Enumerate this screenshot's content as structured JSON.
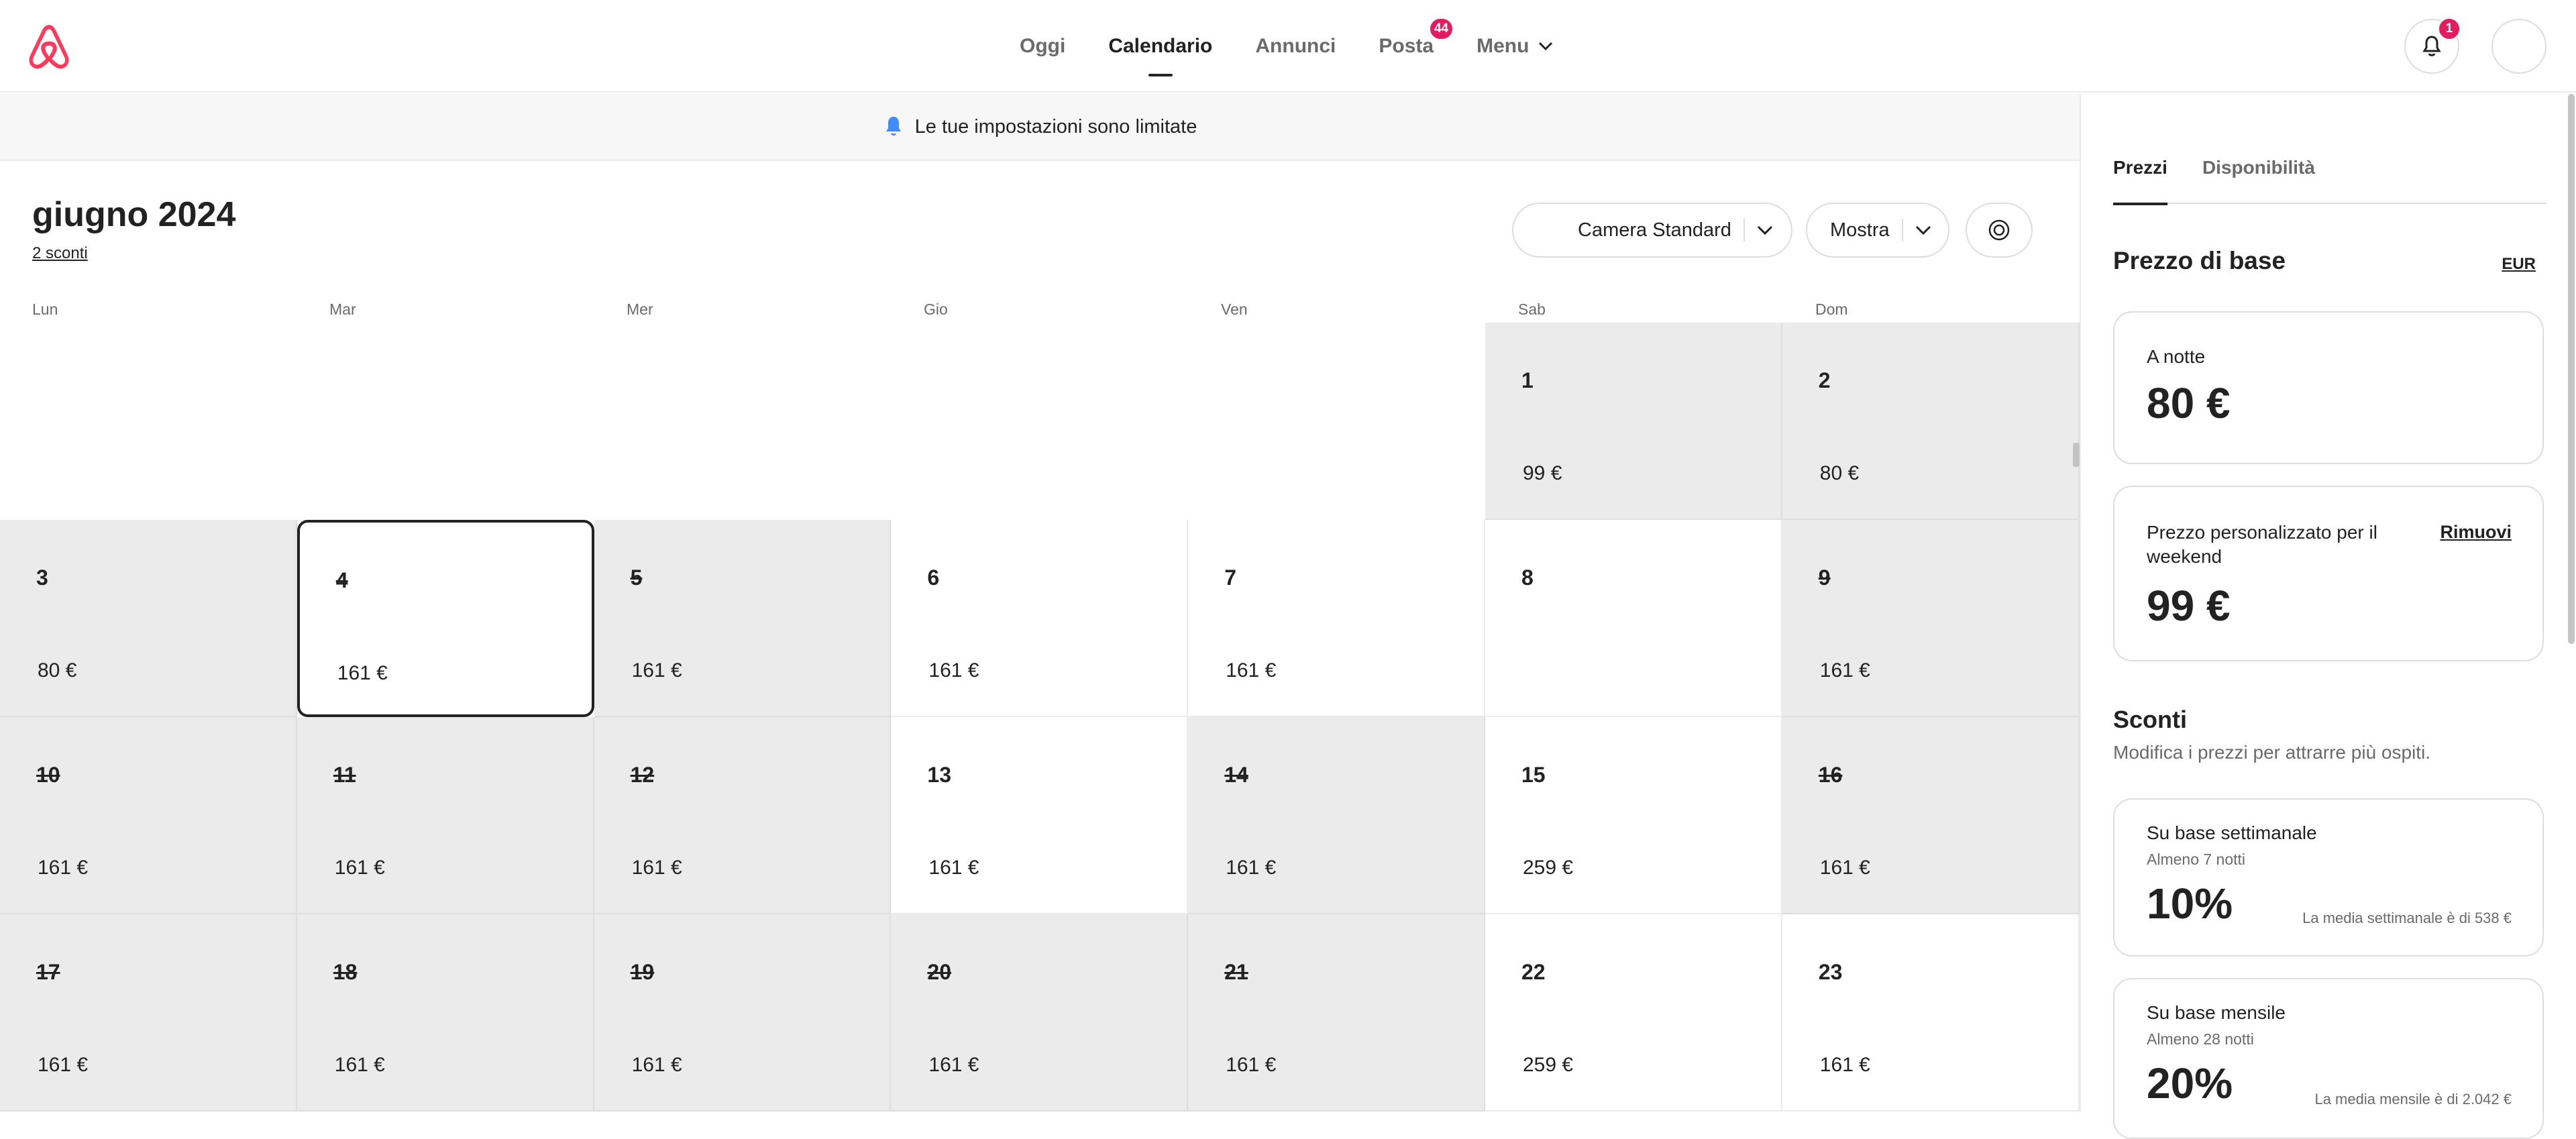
{
  "header": {
    "nav": [
      {
        "label": "Oggi"
      },
      {
        "label": "Calendario"
      },
      {
        "label": "Annunci"
      },
      {
        "label": "Posta",
        "badge": "44"
      },
      {
        "label": "Menu"
      }
    ],
    "notifications_badge": "1"
  },
  "banner": {
    "text": "Le tue impostazioni sono limitate"
  },
  "calendar": {
    "month_title": "giugno 2024",
    "discounts_link": "2 sconti",
    "room_selector": "Camera Standard",
    "show_selector": "Mostra",
    "weekdays": [
      "Lun",
      "Mar",
      "Mer",
      "Gio",
      "Ven",
      "Sab",
      "Dom"
    ],
    "weeks": [
      [
        null,
        null,
        null,
        null,
        null,
        {
          "day": "1",
          "price": "99 €",
          "blocked": true,
          "strike": false
        },
        {
          "day": "2",
          "price": "80 €",
          "blocked": true,
          "strike": false
        }
      ],
      [
        {
          "day": "3",
          "price": "80 €",
          "blocked": true,
          "strike": false
        },
        {
          "day": "4",
          "price": "161 €",
          "blocked": false,
          "strike": true,
          "selected": true
        },
        {
          "day": "5",
          "price": "161 €",
          "blocked": true,
          "strike": true
        },
        {
          "day": "6",
          "price": "161 €",
          "blocked": false,
          "strike": false
        },
        {
          "day": "7",
          "price": "161 €",
          "blocked": false,
          "strike": false
        },
        {
          "day": "8",
          "price": "",
          "blocked": false,
          "strike": false
        },
        {
          "day": "9",
          "price": "161 €",
          "blocked": true,
          "strike": true
        }
      ],
      [
        {
          "day": "10",
          "price": "161 €",
          "blocked": true,
          "strike": true
        },
        {
          "day": "11",
          "price": "161 €",
          "blocked": true,
          "strike": true
        },
        {
          "day": "12",
          "price": "161 €",
          "blocked": true,
          "strike": true
        },
        {
          "day": "13",
          "price": "161 €",
          "blocked": false,
          "strike": false
        },
        {
          "day": "14",
          "price": "161 €",
          "blocked": true,
          "strike": true
        },
        {
          "day": "15",
          "price": "259 €",
          "blocked": false,
          "strike": false
        },
        {
          "day": "16",
          "price": "161 €",
          "blocked": true,
          "strike": true
        }
      ],
      [
        {
          "day": "17",
          "price": "161 €",
          "blocked": true,
          "strike": true
        },
        {
          "day": "18",
          "price": "161 €",
          "blocked": true,
          "strike": true
        },
        {
          "day": "19",
          "price": "161 €",
          "blocked": true,
          "strike": true
        },
        {
          "day": "20",
          "price": "161 €",
          "blocked": true,
          "strike": true
        },
        {
          "day": "21",
          "price": "161 €",
          "blocked": true,
          "strike": true
        },
        {
          "day": "22",
          "price": "259 €",
          "blocked": false,
          "strike": false
        },
        {
          "day": "23",
          "price": "161 €",
          "blocked": false,
          "strike": false
        }
      ]
    ]
  },
  "sidebar": {
    "tabs": [
      {
        "label": "Prezzi"
      },
      {
        "label": "Disponibilità"
      }
    ],
    "base_price_title": "Prezzo di base",
    "currency": "EUR",
    "nightly": {
      "label": "A notte",
      "value": "80 €"
    },
    "weekend": {
      "label": "Prezzo personalizzato per il weekend",
      "value": "99 €",
      "remove_label": "Rimuovi"
    },
    "discounts": {
      "title": "Sconti",
      "subtitle": "Modifica i prezzi per attrarre più ospiti.",
      "weekly": {
        "label": "Su base settimanale",
        "sub": "Almeno 7 notti",
        "value": "10%",
        "note": "La media settimanale è di 538 €"
      },
      "monthly": {
        "label": "Su base mensile",
        "sub": "Almeno 28 notti",
        "value": "20%",
        "note": "La media mensile è di 2.042 €"
      }
    }
  },
  "colors": {
    "brand": "#ff385c",
    "badge": "#e31c5f",
    "bell_blue": "#428bff",
    "blocked_bg": "#ebebeb"
  }
}
